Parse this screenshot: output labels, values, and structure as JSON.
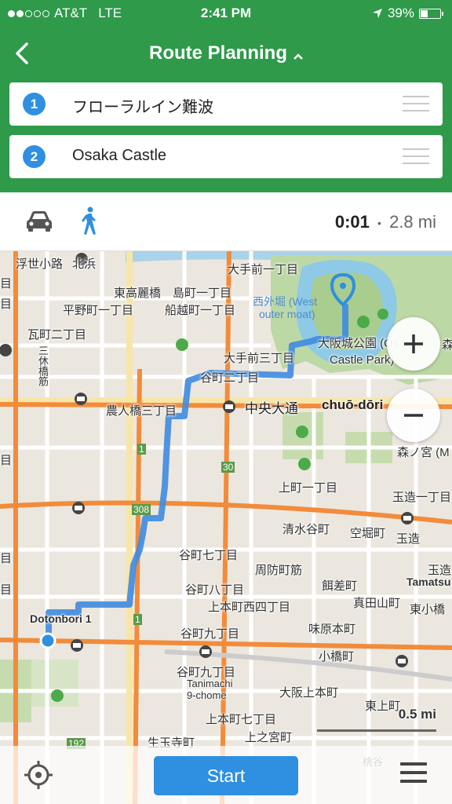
{
  "status": {
    "carrier": "AT&T",
    "network": "LTE",
    "time": "2:41 PM",
    "battery": "39%",
    "battery_level": 0.39
  },
  "nav": {
    "title": "Route Planning"
  },
  "waypoints": [
    {
      "num": "1",
      "name": "フローラルイン難波"
    },
    {
      "num": "2",
      "name": "Osaka Castle"
    }
  ],
  "route": {
    "time": "0:01",
    "separator": "•",
    "distance": "2.8 mi"
  },
  "map": {
    "labels": {
      "l1": "浮世小路",
      "l2": "北浜",
      "l3": "大手前一丁目",
      "l4": "東高麗橋",
      "l5": "島町一丁目",
      "l6": "平野町一丁目",
      "l7": "船越町一丁目",
      "l8": "西外堀 (West",
      "l9": "outer moat)",
      "l10": "瓦町二丁目",
      "l11": "大阪城公園 (Os",
      "l12": "Castle Park)",
      "l13": "大手前三丁目",
      "l14": "谷町二丁目",
      "l15": "農人橋三丁目",
      "l16": "中央大通",
      "l17": "chuō-dōri",
      "l18": "森ノ宮 (M",
      "l19": "上町一丁目",
      "l20": "玉造一丁目",
      "l21": "清水谷町",
      "l22": "空堀町",
      "l23": "玉造",
      "l24": "谷町七丁目",
      "l25": "周防町筋",
      "l26": "玉造",
      "l27": "Tamatsu",
      "l28": "谷町八丁目",
      "l29": "餌差町",
      "l30": "上本町西四丁目",
      "l31": "真田山町",
      "l32": "東小橋",
      "l33": "Dotonbori 1",
      "l34": "谷町九丁目",
      "l35": "味原本町",
      "l36": "小橋町",
      "l37": "谷町九丁目",
      "l38": "Tanimachi",
      "l39": "9-chome",
      "l40": "大阪上本町",
      "l41": "東上町",
      "l42": "上本町七丁目",
      "l43": "上之宮町",
      "l44": "生玉寺町",
      "l45": "桃谷",
      "l46": "三休橋筋",
      "l47": "1",
      "l48": "30",
      "l49": "308",
      "l50": "1",
      "l51": "192",
      "l52": "森",
      "l53": "目",
      "l54": "目",
      "l55": "目",
      "l56": "目",
      "l57": "目"
    },
    "scale": "0.5 mi"
  },
  "bottom": {
    "start_label": "Start"
  }
}
